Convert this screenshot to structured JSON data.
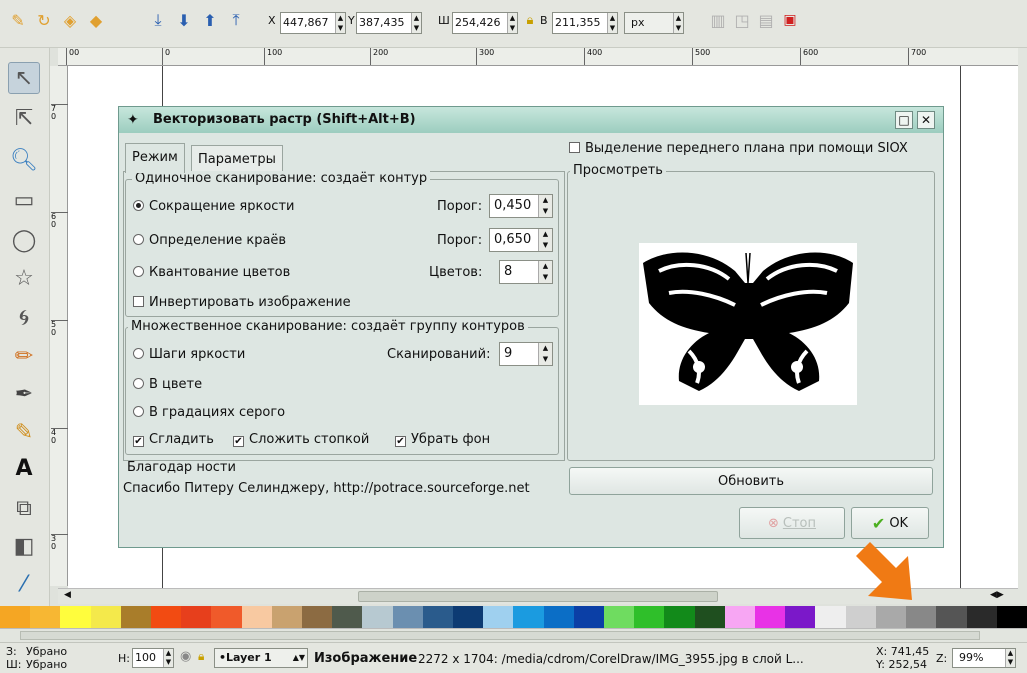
{
  "toolbar": {
    "x_label": "X",
    "x_value": "447,867",
    "y_label": "Y",
    "y_value": "387,435",
    "w_label": "Ш",
    "w_value": "254,426",
    "h_label": "В",
    "h_value": "211,355",
    "units": "px"
  },
  "ruler": {
    "h_ticks": [
      "00",
      "0",
      "100",
      "200",
      "300",
      "400",
      "500",
      "600",
      "700"
    ],
    "v_ticks": [
      "7\n0",
      "6\n0",
      "5\n0",
      "4\n0",
      "3\n0"
    ]
  },
  "dialog": {
    "title": "Векторизовать растр (Shift+Alt+B)",
    "tabs": [
      "Режим",
      "Параметры"
    ],
    "single_scan": {
      "title": "Одиночное сканирование: создаёт контур",
      "options": [
        {
          "label": "Сокращение яркости",
          "param_label": "Порог:",
          "param_value": "0,450",
          "selected": true
        },
        {
          "label": "Определение краёв",
          "param_label": "Порог:",
          "param_value": "0,650",
          "selected": false
        },
        {
          "label": "Квантование цветов",
          "param_label": "Цветов:",
          "param_value": "8",
          "selected": false
        }
      ],
      "invert_label": "Инвертировать изображение"
    },
    "multi_scan": {
      "title": "Множественное сканирование: создаёт группу контуров",
      "options": [
        {
          "label": "Шаги яркости",
          "param_label": "Сканирований:",
          "param_value": "9"
        },
        {
          "label": "В цвете"
        },
        {
          "label": "В градациях серого"
        }
      ],
      "checks": [
        {
          "label": "Сгладить",
          "checked": true
        },
        {
          "label": "Сложить стопкой",
          "checked": true
        },
        {
          "label": "Убрать фон",
          "checked": true
        }
      ]
    },
    "credits_title": "Благодар ности",
    "credits_text": "Спасибо Питеру Селинджеру, http://potrace.sourceforge.net",
    "siox_label": "Выделение переднего плана при помощи SIOX",
    "preview_title": "Просмотреть",
    "update_button": "Обновить",
    "stop_button": "Стоп",
    "ok_button": "OK"
  },
  "palette": [
    "#f5a623",
    "#f7b733",
    "#fffd3d",
    "#f4e94b",
    "#a97d2a",
    "#f24b12",
    "#e73f1c",
    "#f05a2a",
    "#f8c9a1",
    "#c9a26f",
    "#8c6b42",
    "#4f5a4c",
    "#b7c9d1",
    "#6b8fb0",
    "#2a5b8c",
    "#0d3b73",
    "#9fd0ef",
    "#1b9be0",
    "#0b6ec6",
    "#0b3fa6",
    "#6fdc60",
    "#2fbf2a",
    "#128a1a",
    "#1f4f1f",
    "#f7a6f3",
    "#e832e6",
    "#7b18c9",
    "#eeeeee",
    "#cfcfcf",
    "#a9a9a9",
    "#888888",
    "#555555",
    "#2a2a2a",
    "#000000"
  ],
  "status": {
    "fill_label": "З:",
    "fill_value": "Убрано",
    "stroke_label": "Ш:",
    "stroke_value": "Убрано",
    "h_label": "Н:",
    "h_value": "100",
    "layer": "•Layer 1",
    "message_bold": "Изображение",
    "message": "2272 x 1704: /media/cdrom/CorelDraw/IMG_3955.jpg в слой L...",
    "coord_x": "X: 741,45",
    "coord_y": "Y: 252,54",
    "zoom_label": "Z:",
    "zoom": "99%"
  }
}
